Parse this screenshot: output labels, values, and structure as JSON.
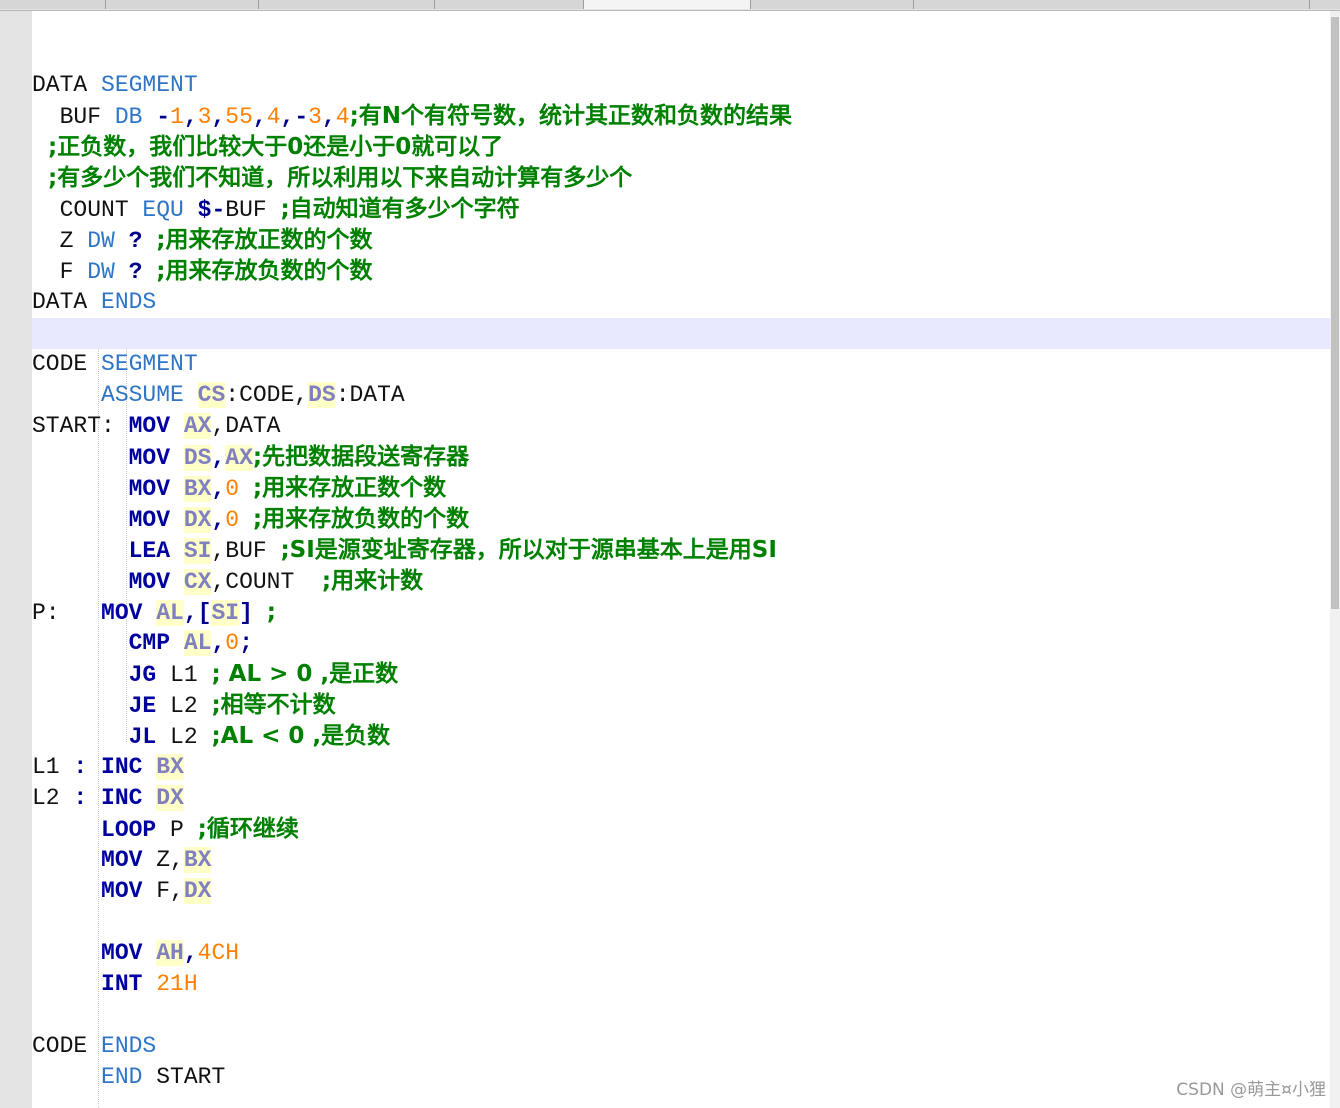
{
  "editor": {
    "lines": [
      {
        "tokens": []
      },
      {
        "tokens": [
          {
            "t": "DATA ",
            "c": "plain"
          },
          {
            "t": "SEGMENT",
            "c": "kw"
          }
        ]
      },
      {
        "tokens": [
          {
            "t": "  BUF ",
            "c": "plain"
          },
          {
            "t": "DB",
            "c": "kw"
          },
          {
            "t": " -",
            "c": "op"
          },
          {
            "t": "1",
            "c": "num"
          },
          {
            "t": ",",
            "c": "op"
          },
          {
            "t": "3",
            "c": "num"
          },
          {
            "t": ",",
            "c": "op"
          },
          {
            "t": "55",
            "c": "num"
          },
          {
            "t": ",",
            "c": "op"
          },
          {
            "t": "4",
            "c": "num"
          },
          {
            "t": ",-",
            "c": "op"
          },
          {
            "t": "3",
            "c": "num"
          },
          {
            "t": ",",
            "c": "op"
          },
          {
            "t": "4",
            "c": "num"
          },
          {
            "t": ";有N个有符号数，统计其正数和负数的结果",
            "c": "cm"
          }
        ]
      },
      {
        "tokens": [
          {
            "t": "  ;正负数，我们比较大于0还是小于0就可以了",
            "c": "cm"
          }
        ]
      },
      {
        "tokens": [
          {
            "t": "  ;有多少个我们不知道，所以利用以下来自动计算有多少个",
            "c": "cm"
          }
        ]
      },
      {
        "tokens": [
          {
            "t": "  COUNT ",
            "c": "plain"
          },
          {
            "t": "EQU",
            "c": "kw"
          },
          {
            "t": " $-",
            "c": "op"
          },
          {
            "t": "BUF ",
            "c": "plain"
          },
          {
            "t": ";自动知道有多少个字符",
            "c": "cm"
          }
        ]
      },
      {
        "tokens": [
          {
            "t": "  Z ",
            "c": "plain"
          },
          {
            "t": "DW",
            "c": "kw"
          },
          {
            "t": " ? ",
            "c": "op"
          },
          {
            "t": ";用来存放正数的个数",
            "c": "cm"
          }
        ]
      },
      {
        "tokens": [
          {
            "t": "  F ",
            "c": "plain"
          },
          {
            "t": "DW",
            "c": "kw"
          },
          {
            "t": " ? ",
            "c": "op"
          },
          {
            "t": ";用来存放负数的个数",
            "c": "cm"
          }
        ]
      },
      {
        "tokens": [
          {
            "t": "DATA ",
            "c": "plain"
          },
          {
            "t": "ENDS",
            "c": "kw"
          }
        ]
      },
      {
        "tokens": [],
        "highlight": true
      },
      {
        "tokens": [
          {
            "t": "CODE ",
            "c": "plain"
          },
          {
            "t": "SEGMENT",
            "c": "kw"
          }
        ]
      },
      {
        "tokens": [
          {
            "t": "     ",
            "c": "plain"
          },
          {
            "t": "ASSUME",
            "c": "kw"
          },
          {
            "t": " ",
            "c": "plain"
          },
          {
            "t": "CS",
            "c": "reg"
          },
          {
            "t": ":CODE,",
            "c": "plain"
          },
          {
            "t": "DS",
            "c": "reg"
          },
          {
            "t": ":DATA",
            "c": "plain"
          }
        ]
      },
      {
        "tokens": [
          {
            "t": "START: ",
            "c": "plain"
          },
          {
            "t": "MOV",
            "c": "ins"
          },
          {
            "t": " ",
            "c": "plain"
          },
          {
            "t": "AX",
            "c": "reg"
          },
          {
            "t": ",DATA",
            "c": "plain"
          }
        ]
      },
      {
        "tokens": [
          {
            "t": "       ",
            "c": "plain"
          },
          {
            "t": "MOV",
            "c": "ins"
          },
          {
            "t": " ",
            "c": "plain"
          },
          {
            "t": "DS",
            "c": "reg"
          },
          {
            "t": ",",
            "c": "op"
          },
          {
            "t": "AX",
            "c": "reg"
          },
          {
            "t": ";先把数据段送寄存器",
            "c": "cm"
          }
        ]
      },
      {
        "tokens": [
          {
            "t": "       ",
            "c": "plain"
          },
          {
            "t": "MOV",
            "c": "ins"
          },
          {
            "t": " ",
            "c": "plain"
          },
          {
            "t": "BX",
            "c": "reg"
          },
          {
            "t": ",",
            "c": "op"
          },
          {
            "t": "0",
            "c": "num"
          },
          {
            "t": " ",
            "c": "plain"
          },
          {
            "t": ";用来存放正数个数",
            "c": "cm"
          }
        ]
      },
      {
        "tokens": [
          {
            "t": "       ",
            "c": "plain"
          },
          {
            "t": "MOV",
            "c": "ins"
          },
          {
            "t": " ",
            "c": "plain"
          },
          {
            "t": "DX",
            "c": "reg"
          },
          {
            "t": ",",
            "c": "op"
          },
          {
            "t": "0",
            "c": "num"
          },
          {
            "t": " ",
            "c": "plain"
          },
          {
            "t": ";用来存放负数的个数",
            "c": "cm"
          }
        ]
      },
      {
        "tokens": [
          {
            "t": "       ",
            "c": "plain"
          },
          {
            "t": "LEA",
            "c": "ins"
          },
          {
            "t": " ",
            "c": "plain"
          },
          {
            "t": "SI",
            "c": "reg"
          },
          {
            "t": ",BUF ",
            "c": "plain"
          },
          {
            "t": ";SI是源变址寄存器，所以对于源串基本上是用SI",
            "c": "cm"
          }
        ]
      },
      {
        "tokens": [
          {
            "t": "       ",
            "c": "plain"
          },
          {
            "t": "MOV",
            "c": "ins"
          },
          {
            "t": " ",
            "c": "plain"
          },
          {
            "t": "CX",
            "c": "reg"
          },
          {
            "t": ",COUNT  ",
            "c": "plain"
          },
          {
            "t": ";用来计数",
            "c": "cm"
          }
        ]
      },
      {
        "tokens": [
          {
            "t": "P:   ",
            "c": "plain"
          },
          {
            "t": "MOV",
            "c": "ins"
          },
          {
            "t": " ",
            "c": "plain"
          },
          {
            "t": "AL",
            "c": "reg"
          },
          {
            "t": ",[",
            "c": "op"
          },
          {
            "t": "SI",
            "c": "reg"
          },
          {
            "t": "] ",
            "c": "op"
          },
          {
            "t": ";",
            "c": "cm"
          }
        ]
      },
      {
        "tokens": [
          {
            "t": "       ",
            "c": "plain"
          },
          {
            "t": "CMP",
            "c": "ins"
          },
          {
            "t": " ",
            "c": "plain"
          },
          {
            "t": "AL",
            "c": "reg"
          },
          {
            "t": ",",
            "c": "op"
          },
          {
            "t": "0",
            "c": "num"
          },
          {
            "t": ";",
            "c": "op"
          }
        ]
      },
      {
        "tokens": [
          {
            "t": "       ",
            "c": "plain"
          },
          {
            "t": "JG",
            "c": "ins"
          },
          {
            "t": " L1 ",
            "c": "plain"
          },
          {
            "t": "; AL > 0 ,是正数",
            "c": "cm"
          }
        ]
      },
      {
        "tokens": [
          {
            "t": "       ",
            "c": "plain"
          },
          {
            "t": "JE",
            "c": "ins"
          },
          {
            "t": " L2 ",
            "c": "plain"
          },
          {
            "t": ";相等不计数",
            "c": "cm"
          }
        ]
      },
      {
        "tokens": [
          {
            "t": "       ",
            "c": "plain"
          },
          {
            "t": "JL",
            "c": "ins"
          },
          {
            "t": " L2 ",
            "c": "plain"
          },
          {
            "t": ";AL < 0 ,是负数",
            "c": "cm"
          }
        ]
      },
      {
        "tokens": [
          {
            "t": "L1 ",
            "c": "plain"
          },
          {
            "t": ":",
            "c": "op"
          },
          {
            "t": " ",
            "c": "plain"
          },
          {
            "t": "INC",
            "c": "ins"
          },
          {
            "t": " ",
            "c": "plain"
          },
          {
            "t": "BX",
            "c": "reg"
          }
        ]
      },
      {
        "tokens": [
          {
            "t": "L2 ",
            "c": "plain"
          },
          {
            "t": ":",
            "c": "op"
          },
          {
            "t": " ",
            "c": "plain"
          },
          {
            "t": "INC",
            "c": "ins"
          },
          {
            "t": " ",
            "c": "plain"
          },
          {
            "t": "DX",
            "c": "reg"
          }
        ]
      },
      {
        "tokens": [
          {
            "t": "     ",
            "c": "plain"
          },
          {
            "t": "LOOP",
            "c": "ins"
          },
          {
            "t": " P ",
            "c": "plain"
          },
          {
            "t": ";循环继续",
            "c": "cm"
          }
        ]
      },
      {
        "tokens": [
          {
            "t": "     ",
            "c": "plain"
          },
          {
            "t": "MOV",
            "c": "ins"
          },
          {
            "t": " Z,",
            "c": "plain"
          },
          {
            "t": "BX",
            "c": "reg"
          }
        ]
      },
      {
        "tokens": [
          {
            "t": "     ",
            "c": "plain"
          },
          {
            "t": "MOV",
            "c": "ins"
          },
          {
            "t": " F,",
            "c": "plain"
          },
          {
            "t": "DX",
            "c": "reg"
          }
        ]
      },
      {
        "tokens": []
      },
      {
        "tokens": [
          {
            "t": "     ",
            "c": "plain"
          },
          {
            "t": "MOV",
            "c": "ins"
          },
          {
            "t": " ",
            "c": "plain"
          },
          {
            "t": "AH",
            "c": "reg"
          },
          {
            "t": ",",
            "c": "op"
          },
          {
            "t": "4CH",
            "c": "num"
          }
        ]
      },
      {
        "tokens": [
          {
            "t": "     ",
            "c": "plain"
          },
          {
            "t": "INT",
            "c": "ins"
          },
          {
            "t": " ",
            "c": "plain"
          },
          {
            "t": "21H",
            "c": "num"
          }
        ]
      },
      {
        "tokens": []
      },
      {
        "tokens": [
          {
            "t": "CODE ",
            "c": "plain"
          },
          {
            "t": "ENDS",
            "c": "kw"
          }
        ]
      },
      {
        "tokens": [
          {
            "t": "     ",
            "c": "plain"
          },
          {
            "t": "END",
            "c": "kw"
          },
          {
            "t": " START",
            "c": "plain"
          }
        ]
      }
    ]
  },
  "watermark": "CSDN @萌主¤小狸"
}
